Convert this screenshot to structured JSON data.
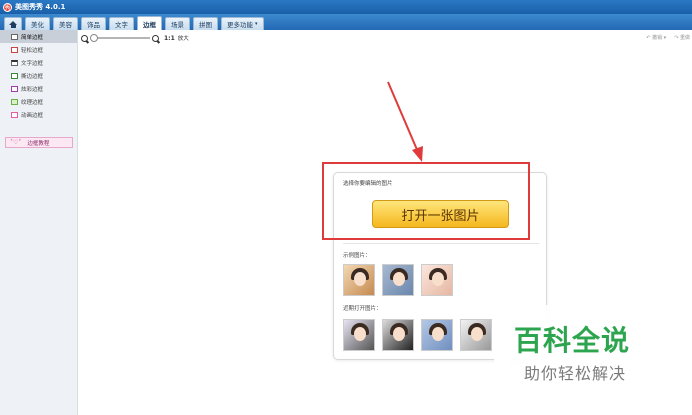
{
  "app": {
    "title": "美图秀秀 4.0.1",
    "logo_glyph": "秀"
  },
  "tabs": [
    {
      "label": "",
      "icon": "home-icon"
    },
    {
      "label": "美化"
    },
    {
      "label": "美容"
    },
    {
      "label": "饰品"
    },
    {
      "label": "文字"
    },
    {
      "label": "边框",
      "active": true
    },
    {
      "label": "场景"
    },
    {
      "label": "拼图"
    },
    {
      "label": "更多功能",
      "caret": "▾"
    }
  ],
  "sidebar": {
    "items": [
      {
        "label": "简单边框",
        "icon": "frame-icon",
        "active": true
      },
      {
        "label": "轻松边框",
        "icon": "frame-red-icon"
      },
      {
        "label": "文字边框",
        "icon": "frame-text-icon"
      },
      {
        "label": "撕边边框",
        "icon": "frame-green-icon"
      },
      {
        "label": "炫彩边框",
        "icon": "frame-purple-icon"
      },
      {
        "label": "纹理边框",
        "icon": "frame-texture-icon"
      },
      {
        "label": "动画边框",
        "icon": "frame-pink-icon"
      }
    ],
    "tutorial_button": {
      "label": "边框教程",
      "icon_glyph": "˂♡˃"
    }
  },
  "toolbar": {
    "zoom_ratio": "1:1",
    "zoom_max_label": "放大",
    "zoom_level": 0,
    "undo_label": "撤销",
    "redo_label": "重做"
  },
  "card": {
    "prompt": "选择你要编辑的图片",
    "open_button": "打开一张图片",
    "sample_label": "示例图片：",
    "recent_label": "近期打开图片："
  },
  "watermark": {
    "title": "百科全说",
    "subtitle": "助你轻松解决"
  },
  "colors": {
    "accent_blue": "#2369b3",
    "open_button": "#f5b71e",
    "annotation_red": "#e03b3b",
    "watermark_green": "#27a34a"
  }
}
